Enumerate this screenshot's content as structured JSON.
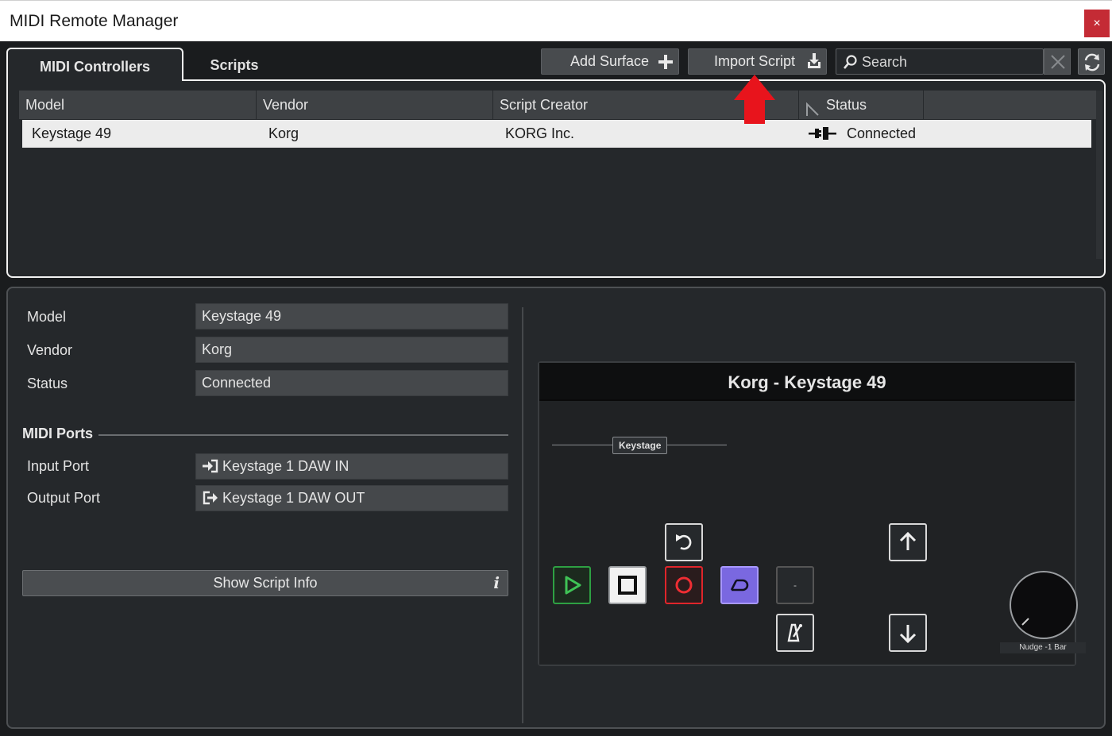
{
  "window": {
    "title": "MIDI Remote Manager",
    "close_glyph": "×"
  },
  "tabs": [
    {
      "label": "MIDI Controllers"
    },
    {
      "label": "Scripts"
    }
  ],
  "toolbar": {
    "add_surface_label": "Add Surface",
    "add_surface_icon": "plus-icon",
    "import_script_label": "Import Script",
    "import_script_icon": "import-icon",
    "search_placeholder": "Search",
    "clear_icon": "close-icon",
    "refresh_icon": "refresh-icon"
  },
  "table": {
    "columns": [
      "Model",
      "Vendor",
      "Script Creator",
      "Status"
    ],
    "rows": [
      {
        "model": "Keystage 49",
        "vendor": "Korg",
        "script_creator": "KORG Inc.",
        "status": "Connected",
        "status_icon": "plug-connected-icon"
      }
    ]
  },
  "details": {
    "model_label": "Model",
    "model_value": "Keystage 49",
    "vendor_label": "Vendor",
    "vendor_value": "Korg",
    "status_label": "Status",
    "status_value": "Connected",
    "midi_ports_heading": "MIDI Ports",
    "input_port_label": "Input Port",
    "input_port_value": "Keystage 1 DAW IN",
    "output_port_label": "Output Port",
    "output_port_value": "Keystage 1 DAW OUT",
    "show_script_info_label": "Show Script Info",
    "info_glyph": "i"
  },
  "surface": {
    "title": "Korg - Keystage 49",
    "device_label": "Keystage",
    "dash_button_label": "-",
    "knob_label": "Nudge -1 Bar",
    "buttons": [
      "undo",
      "play",
      "stop",
      "record",
      "cycle",
      "blank",
      "metronome",
      "up",
      "down"
    ],
    "colors": {
      "play": "#2ea043",
      "record": "#e0252b",
      "cycle": "#7a68e0",
      "stop": "#f2f2f2"
    }
  },
  "annotation": {
    "arrow_color": "#e8141c",
    "points_to": "import-script-button"
  }
}
